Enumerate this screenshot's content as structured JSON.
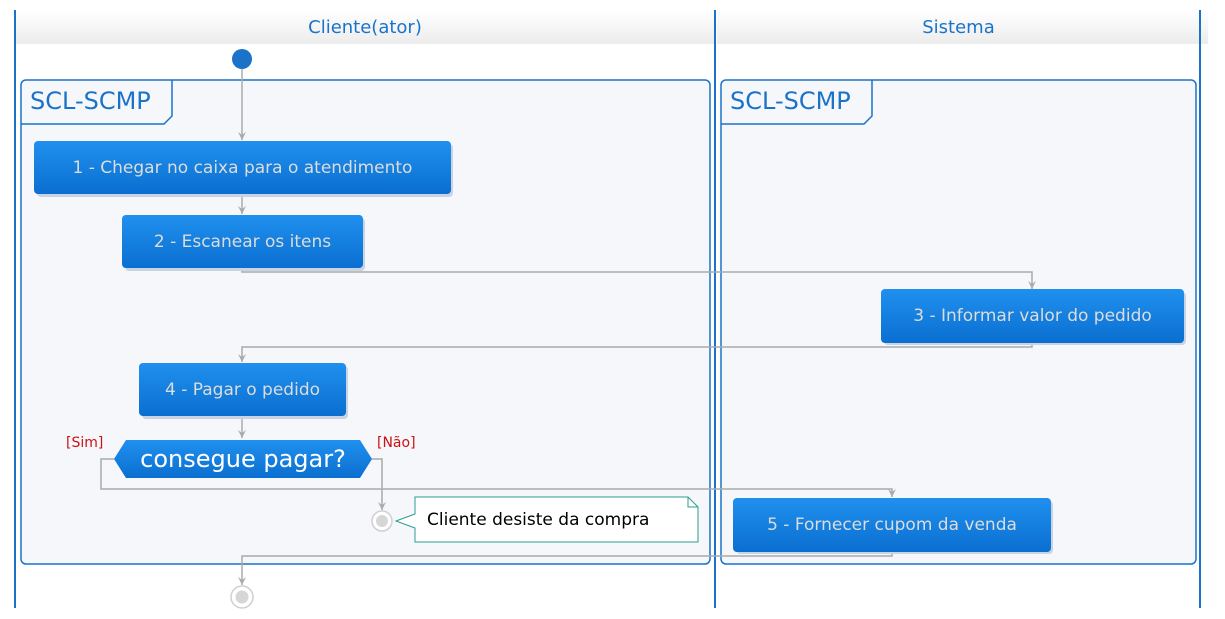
{
  "lanes": {
    "left": {
      "title": "Cliente(ator)"
    },
    "right": {
      "title": "Sistema"
    }
  },
  "frames": {
    "left": {
      "label": "SCL-SCMP"
    },
    "right": {
      "label": "SCL-SCMP"
    }
  },
  "actions": {
    "a1": "1 - Chegar no caixa para o atendimento",
    "a2": "2 - Escanear os itens",
    "a3": "3 - Informar valor do pedido",
    "a4": "4 - Pagar o pedido",
    "a5": "5 - Fornecer cupom da venda"
  },
  "decision": {
    "label": "consegue pagar?",
    "yes_guard": "[Sim]",
    "no_guard": "[Não]"
  },
  "note": {
    "text": "Cliente desiste da compra"
  },
  "colors": {
    "accent": "#1a73c9",
    "action_fill": "#1683e8",
    "arrow": "#aaaaaa",
    "guard": "#cc1111",
    "note_border": "#2a9d8f",
    "frame_bg": "#f5f7fb"
  }
}
